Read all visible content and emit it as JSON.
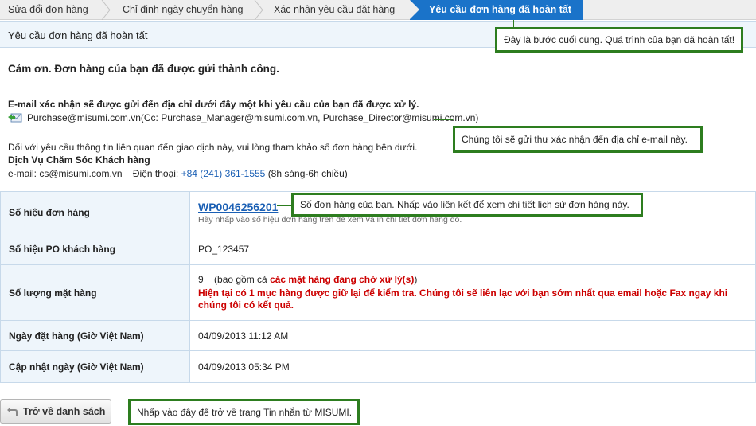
{
  "steps": {
    "step1": "Sửa đổi đơn hàng",
    "step2": "Chỉ định ngày chuyển hàng",
    "step3": "Xác nhận yêu cầu đặt hàng",
    "step4": "Yêu cầu đơn hàng đã hoàn tất"
  },
  "section_title": "Yêu cầu đơn hàng đã hoàn tất",
  "thanks": "Cảm ơn. Đơn hàng của bạn đã được gửi thành công.",
  "email_note": "E-mail xác nhận sẽ được gửi đến địa chỉ dưới đây một khi yêu cầu của bạn đã được xử lý.",
  "email_addresses": "Purchase@misumi.com.vn(Cc: Purchase_Manager@misumi.com.vn, Purchase_Director@misumi.com.vn)",
  "inquiry_note": "Đối với yêu cầu thông tin liên quan đến giao dịch này, vui lòng tham khảo số đơn hàng bên dưới.",
  "customer_service": {
    "title": "Dịch Vụ Chăm Sóc Khách hàng",
    "email_label": "e-mail: cs@misumi.com.vn",
    "phone_label": "Điện thoại:",
    "phone": "+84 (241) 361-1555",
    "hours": "(8h sáng-6h chiều)"
  },
  "table": {
    "order_no_label": "Số hiệu đơn hàng",
    "order_no": "WP0046256201",
    "order_hint": "Hãy nhấp vào số hiệu đơn hàng trên để xem và in chi tiết đơn hàng đó.",
    "po_label": "Số hiệu PO khách hàng",
    "po_value": "PO_123457",
    "qty_label": "Số lượng mặt hàng",
    "qty_value": "9",
    "qty_including": "(bao gồm cả",
    "qty_pending": "các mặt hàng đang chờ xử lý(s)",
    "qty_close": ")",
    "qty_warning": "Hiện tại có 1 mục hàng được giữ lại để kiểm tra. Chúng tôi sẽ liên lạc với bạn sớm nhất qua email hoặc Fax ngay khi chúng tôi có kết quả.",
    "order_date_label": "Ngày đặt hàng (Giờ Việt Nam)",
    "order_date": "04/09/2013 11:12 AM",
    "update_date_label": "Cập nhật ngày (Giờ Việt Nam)",
    "update_date": "04/09/2013 05:34 PM"
  },
  "back_button": "Trở về danh sách",
  "callouts": {
    "final_step": "Đây là bước cuối cùng. Quá trình của bạn đã hoàn tất!",
    "email_sent": "Chúng tôi sẽ gửi thư xác nhận đến địa chỉ e-mail này.",
    "order_number": "Số đơn hàng của bạn. Nhấp vào liên kết để xem chi tiết lịch sử đơn hàng này.",
    "back": "Nhấp vào đây để trở về trang Tin nhắn từ MISUMI."
  },
  "colors": {
    "active_step": "#1a73c9",
    "callout_border": "#2d7d1f",
    "link": "#1a5fb4",
    "warning": "#cc0000"
  }
}
